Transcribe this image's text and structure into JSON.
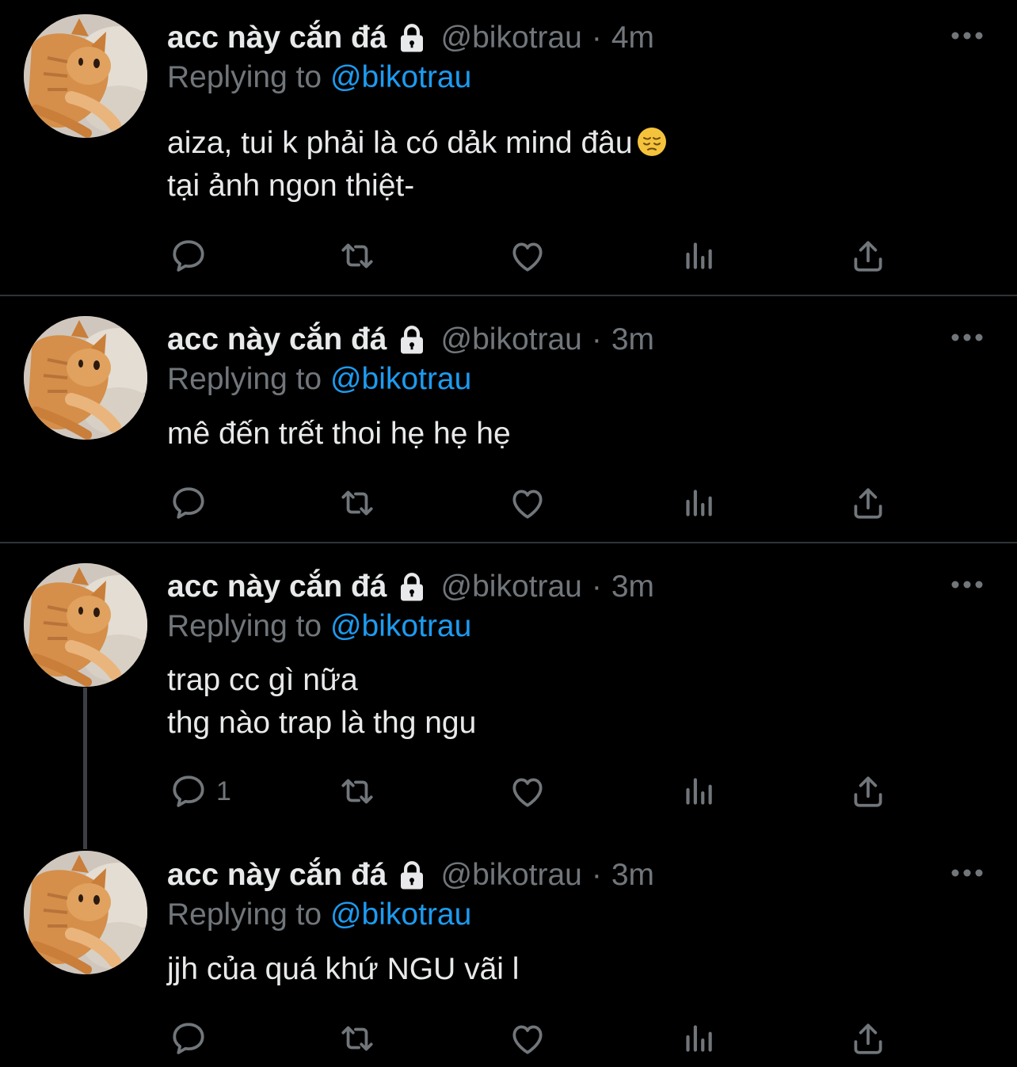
{
  "colors": {
    "background": "#000000",
    "text_primary": "#e7e9ea",
    "text_secondary": "#71767b",
    "link": "#1d9bf0",
    "divider": "#2f3336"
  },
  "tweets": [
    {
      "display_name": "acc này cắn đá",
      "handle": "@bikotrau",
      "separator": "·",
      "time": "4m",
      "replying_prefix": "Replying to",
      "replying_to": "@bikotrau",
      "lines": [
        "aiza, tui k phải là có dảk mind đâu",
        "tại ảnh ngon thiệt-"
      ],
      "emoji": "pensive-face-icon",
      "reply_count": ""
    },
    {
      "display_name": "acc này cắn đá",
      "handle": "@bikotrau",
      "separator": "·",
      "time": "3m",
      "replying_prefix": "Replying to",
      "replying_to": "@bikotrau",
      "lines": [
        "mê đến trết thoi hẹ hẹ hẹ"
      ],
      "reply_count": ""
    },
    {
      "display_name": "acc này cắn đá",
      "handle": "@bikotrau",
      "separator": "·",
      "time": "3m",
      "replying_prefix": "Replying to",
      "replying_to": "@bikotrau",
      "lines": [
        "trap cc gì nữa",
        "thg nào trap là thg ngu"
      ],
      "reply_count": "1"
    },
    {
      "display_name": "acc này cắn đá",
      "handle": "@bikotrau",
      "separator": "·",
      "time": "3m",
      "replying_prefix": "Replying to",
      "replying_to": "@bikotrau",
      "lines": [
        "jjh của quá khứ NGU vãi l"
      ],
      "reply_count": ""
    }
  ],
  "icons": {
    "more": "more-icon",
    "reply": "reply-icon",
    "retweet": "retweet-icon",
    "like": "like-icon",
    "views": "views-icon",
    "share": "share-icon",
    "lock": "lock-icon"
  }
}
